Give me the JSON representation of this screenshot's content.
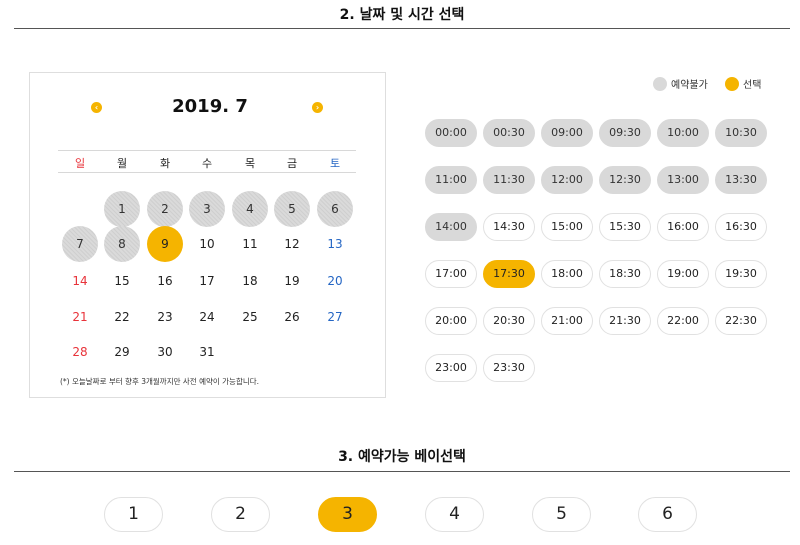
{
  "section_date": {
    "title": "2. 날짜 및 시간 선택"
  },
  "calendar": {
    "title": "2019. 7",
    "prev_icon": "chevron-left-icon",
    "next_icon": "chevron-right-icon",
    "weekdays": [
      "일",
      "월",
      "화",
      "수",
      "목",
      "금",
      "토"
    ],
    "weeks": [
      [
        null,
        {
          "d": "1",
          "s": "disabled"
        },
        {
          "d": "2",
          "s": "disabled"
        },
        {
          "d": "3",
          "s": "disabled"
        },
        {
          "d": "4",
          "s": "disabled"
        },
        {
          "d": "5",
          "s": "disabled"
        },
        {
          "d": "6",
          "s": "disabled"
        }
      ],
      [
        {
          "d": "7",
          "s": "disabled"
        },
        {
          "d": "8",
          "s": "disabled"
        },
        {
          "d": "9",
          "s": "selected"
        },
        {
          "d": "10",
          "s": "normal"
        },
        {
          "d": "11",
          "s": "normal"
        },
        {
          "d": "12",
          "s": "normal"
        },
        {
          "d": "13",
          "s": "normal"
        }
      ],
      [
        {
          "d": "14",
          "s": "normal"
        },
        {
          "d": "15",
          "s": "normal"
        },
        {
          "d": "16",
          "s": "normal"
        },
        {
          "d": "17",
          "s": "normal"
        },
        {
          "d": "18",
          "s": "normal"
        },
        {
          "d": "19",
          "s": "normal"
        },
        {
          "d": "20",
          "s": "normal"
        }
      ],
      [
        {
          "d": "21",
          "s": "normal"
        },
        {
          "d": "22",
          "s": "normal"
        },
        {
          "d": "23",
          "s": "normal"
        },
        {
          "d": "24",
          "s": "normal"
        },
        {
          "d": "25",
          "s": "normal"
        },
        {
          "d": "26",
          "s": "normal"
        },
        {
          "d": "27",
          "s": "normal"
        }
      ],
      [
        {
          "d": "28",
          "s": "normal"
        },
        {
          "d": "29",
          "s": "normal"
        },
        {
          "d": "30",
          "s": "normal"
        },
        {
          "d": "31",
          "s": "normal"
        },
        null,
        null,
        null
      ]
    ],
    "note": "(*) 오늘날짜로 부터 향후 3개월까지만 사전 예약이 가능합니다."
  },
  "legend": {
    "unavailable": "예약불가",
    "selected": "선택"
  },
  "time_slots": [
    {
      "t": "00:00",
      "s": "disabled"
    },
    {
      "t": "00:30",
      "s": "disabled"
    },
    {
      "t": "09:00",
      "s": "disabled"
    },
    {
      "t": "09:30",
      "s": "disabled"
    },
    {
      "t": "10:00",
      "s": "disabled"
    },
    {
      "t": "10:30",
      "s": "disabled"
    },
    {
      "t": "11:00",
      "s": "disabled"
    },
    {
      "t": "11:30",
      "s": "disabled"
    },
    {
      "t": "12:00",
      "s": "disabled"
    },
    {
      "t": "12:30",
      "s": "disabled"
    },
    {
      "t": "13:00",
      "s": "disabled"
    },
    {
      "t": "13:30",
      "s": "disabled"
    },
    {
      "t": "14:00",
      "s": "disabled"
    },
    {
      "t": "14:30",
      "s": "normal"
    },
    {
      "t": "15:00",
      "s": "normal"
    },
    {
      "t": "15:30",
      "s": "normal"
    },
    {
      "t": "16:00",
      "s": "normal"
    },
    {
      "t": "16:30",
      "s": "normal"
    },
    {
      "t": "17:00",
      "s": "normal"
    },
    {
      "t": "17:30",
      "s": "selected"
    },
    {
      "t": "18:00",
      "s": "normal"
    },
    {
      "t": "18:30",
      "s": "normal"
    },
    {
      "t": "19:00",
      "s": "normal"
    },
    {
      "t": "19:30",
      "s": "normal"
    },
    {
      "t": "20:00",
      "s": "normal"
    },
    {
      "t": "20:30",
      "s": "normal"
    },
    {
      "t": "21:00",
      "s": "normal"
    },
    {
      "t": "21:30",
      "s": "normal"
    },
    {
      "t": "22:00",
      "s": "normal"
    },
    {
      "t": "22:30",
      "s": "normal"
    },
    {
      "t": "23:00",
      "s": "normal"
    },
    {
      "t": "23:30",
      "s": "normal"
    }
  ],
  "section_bay": {
    "title": "3. 예약가능 베이선택",
    "bays": [
      {
        "label": "1",
        "s": "normal"
      },
      {
        "label": "2",
        "s": "normal"
      },
      {
        "label": "3",
        "s": "selected"
      },
      {
        "label": "4",
        "s": "normal"
      },
      {
        "label": "5",
        "s": "normal"
      },
      {
        "label": "6",
        "s": "normal"
      }
    ]
  },
  "colors": {
    "accent": "#f5b400",
    "disabled": "#d9d9d9",
    "sunday": "#e8333a",
    "saturday": "#2566c4"
  }
}
